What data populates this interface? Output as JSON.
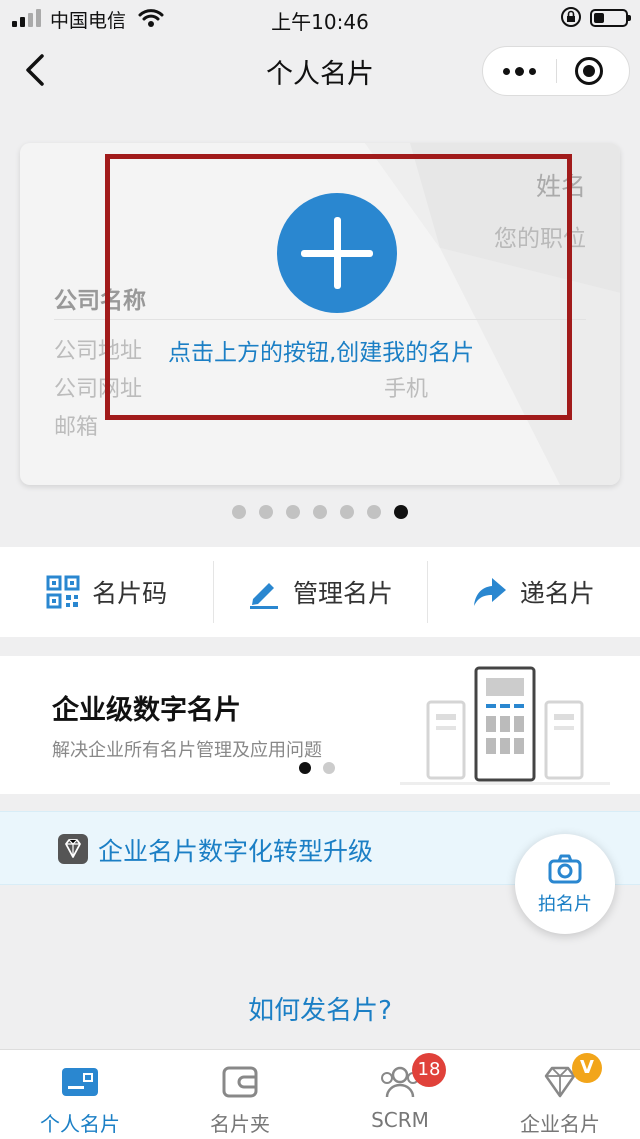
{
  "status_bar": {
    "carrier": "中国电信",
    "time": "上午10:46"
  },
  "nav": {
    "title": "个人名片"
  },
  "card": {
    "name": "姓名",
    "job_title": "您的职位",
    "company": "公司名称",
    "address": "公司地址",
    "website": "公司网址",
    "email": "邮箱",
    "phone": "手机",
    "create_hint": "点击上方的按钮,创建我的名片"
  },
  "pager": {
    "total": 7,
    "active_index": 6
  },
  "actions": [
    {
      "label": "名片码",
      "icon": "qr-code-icon"
    },
    {
      "label": "管理名片",
      "icon": "pencil-icon"
    },
    {
      "label": "递名片",
      "icon": "share-arrow-icon"
    }
  ],
  "promo": {
    "title": "企业级数字名片",
    "subtitle": "解决企业所有名片管理及应用问题",
    "slides_total": 2,
    "active_slide": 0
  },
  "upgrade": {
    "text": "企业名片数字化转型升级",
    "icon": "diamond-icon"
  },
  "fab": {
    "label": "拍名片",
    "icon": "camera-icon"
  },
  "howto": "如何发名片?",
  "tabs": [
    {
      "label": "个人名片",
      "icon": "card-icon",
      "active": true
    },
    {
      "label": "名片夹",
      "icon": "wallet-icon",
      "active": false
    },
    {
      "label": "SCRM",
      "icon": "people-icon",
      "active": false,
      "badge": "18"
    },
    {
      "label": "企业名片",
      "icon": "diamond-icon",
      "active": false,
      "badge": "V"
    }
  ],
  "colors": {
    "accent": "#1b7fc5",
    "add_button": "#2a87d0",
    "highlight_border": "#a11b1b",
    "badge_red": "#e0413a",
    "badge_gold": "#f2a51a"
  }
}
